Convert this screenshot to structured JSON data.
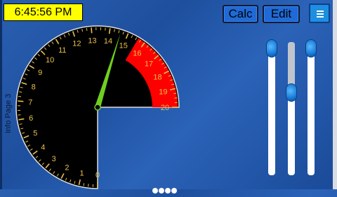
{
  "header": {
    "clock_text": "6:45:56 PM",
    "calc_label": "Calc",
    "edit_label": "Edit",
    "menu_icon": "hamburger-menu-icon"
  },
  "side_label": "Info Page 3",
  "gauge": {
    "ticks": [
      "0",
      "1",
      "2",
      "3",
      "4",
      "5",
      "6",
      "7",
      "8",
      "9",
      "10",
      "11",
      "12",
      "13",
      "14",
      "15",
      "16",
      "17",
      "18",
      "19",
      "20"
    ],
    "needle_value": 14.6,
    "redline_from": 15.6,
    "colors": {
      "face": "#000000",
      "redline": "#ff0000",
      "needle": "#6fcf1f",
      "ticks": "#e8c04a"
    }
  },
  "sliders": [
    {
      "name": "slider-1",
      "level": 1.0
    },
    {
      "name": "slider-2",
      "level": 0.65
    },
    {
      "name": "slider-3",
      "level": 1.0
    }
  ],
  "page_dots": 4
}
